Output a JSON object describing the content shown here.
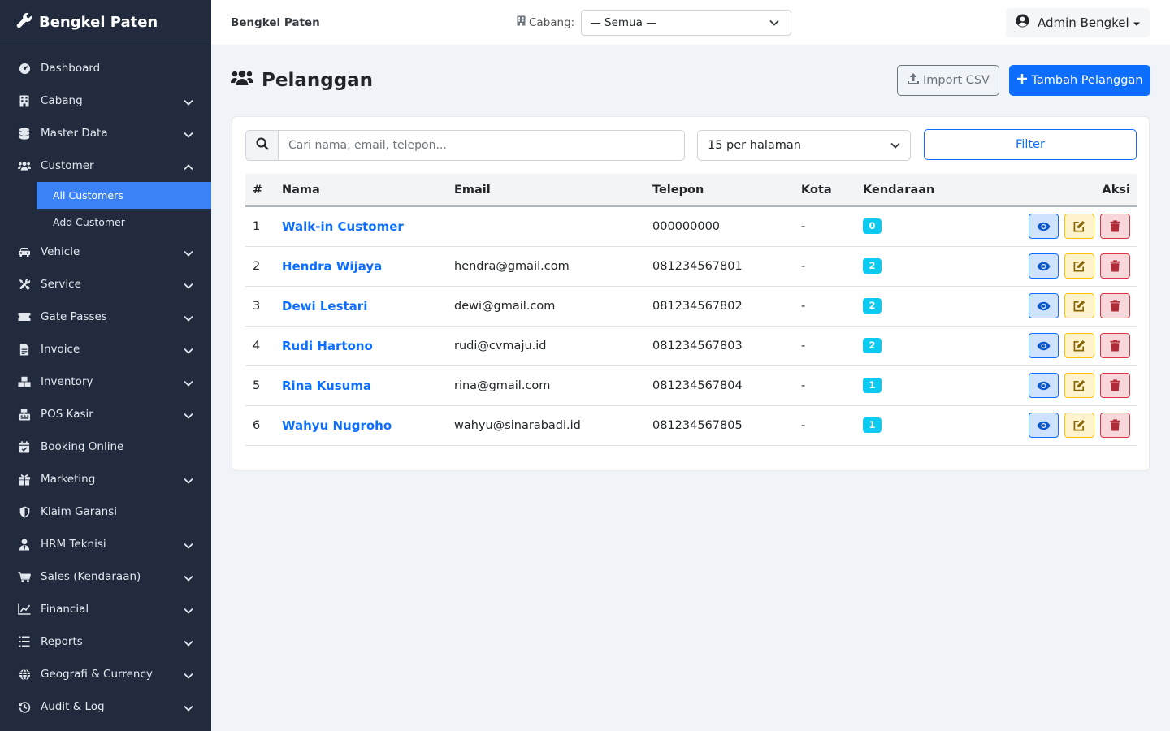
{
  "brand": {
    "name": "Bengkel Paten"
  },
  "sidebar": {
    "items": [
      {
        "label": "Dashboard",
        "icon": "dashboard-icon",
        "has_children": false
      },
      {
        "label": "Cabang",
        "icon": "building-icon",
        "has_children": true
      },
      {
        "label": "Master Data",
        "icon": "database-icon",
        "has_children": true
      },
      {
        "label": "Customer",
        "icon": "users-icon",
        "has_children": true,
        "expanded": true,
        "children": [
          {
            "label": "All Customers",
            "active": true
          },
          {
            "label": "Add Customer",
            "active": false
          }
        ]
      },
      {
        "label": "Vehicle",
        "icon": "car-icon",
        "has_children": true
      },
      {
        "label": "Service",
        "icon": "tools-icon",
        "has_children": true
      },
      {
        "label": "Gate Passes",
        "icon": "ticket-icon",
        "has_children": true
      },
      {
        "label": "Invoice",
        "icon": "invoice-icon",
        "has_children": true
      },
      {
        "label": "Inventory",
        "icon": "boxes-icon",
        "has_children": true
      },
      {
        "label": "POS Kasir",
        "icon": "cash-register-icon",
        "has_children": true
      },
      {
        "label": "Booking Online",
        "icon": "calendar-check-icon",
        "has_children": false
      },
      {
        "label": "Marketing",
        "icon": "gift-icon",
        "has_children": true
      },
      {
        "label": "Klaim Garansi",
        "icon": "shield-icon",
        "has_children": false
      },
      {
        "label": "HRM Teknisi",
        "icon": "user-tie-icon",
        "has_children": true
      },
      {
        "label": "Sales (Kendaraan)",
        "icon": "cart-icon",
        "has_children": true
      },
      {
        "label": "Financial",
        "icon": "chart-line-icon",
        "has_children": true
      },
      {
        "label": "Reports",
        "icon": "list-icon",
        "has_children": true
      },
      {
        "label": "Geografi & Currency",
        "icon": "globe-icon",
        "has_children": true
      },
      {
        "label": "Audit & Log",
        "icon": "history-icon",
        "has_children": true
      }
    ]
  },
  "topbar": {
    "title": "Bengkel Paten",
    "branch_label": "Cabang:",
    "branch_value": "— Semua —",
    "user_name": "Admin Bengkel"
  },
  "page": {
    "title": "Pelanggan",
    "import_label": "Import CSV",
    "add_label": "Tambah Pelanggan"
  },
  "filters": {
    "search_placeholder": "Cari nama, email, telepon...",
    "per_page": "15 per halaman",
    "filter_label": "Filter"
  },
  "table": {
    "headers": [
      "#",
      "Nama",
      "Email",
      "Telepon",
      "Kota",
      "Kendaraan",
      "Aksi"
    ],
    "rows": [
      {
        "no": "1",
        "name": "Walk-in Customer",
        "email": "",
        "phone": "000000000",
        "city": "-",
        "vehicles": "0"
      },
      {
        "no": "2",
        "name": "Hendra Wijaya",
        "email": "hendra@gmail.com",
        "phone": "081234567801",
        "city": "-",
        "vehicles": "2"
      },
      {
        "no": "3",
        "name": "Dewi Lestari",
        "email": "dewi@gmail.com",
        "phone": "081234567802",
        "city": "-",
        "vehicles": "2"
      },
      {
        "no": "4",
        "name": "Rudi Hartono",
        "email": "rudi@cvmaju.id",
        "phone": "081234567803",
        "city": "-",
        "vehicles": "2"
      },
      {
        "no": "5",
        "name": "Rina Kusuma",
        "email": "rina@gmail.com",
        "phone": "081234567804",
        "city": "-",
        "vehicles": "1"
      },
      {
        "no": "6",
        "name": "Wahyu Nugroho",
        "email": "wahyu@sinarabadi.id",
        "phone": "081234567805",
        "city": "-",
        "vehicles": "1"
      }
    ]
  },
  "colors": {
    "sidebar_bg": "#212b3d",
    "active_item": "#3b82f6",
    "primary": "#0d6efd",
    "badge": "#0dcaf0",
    "warning": "#ffc107",
    "danger": "#dc3545"
  }
}
